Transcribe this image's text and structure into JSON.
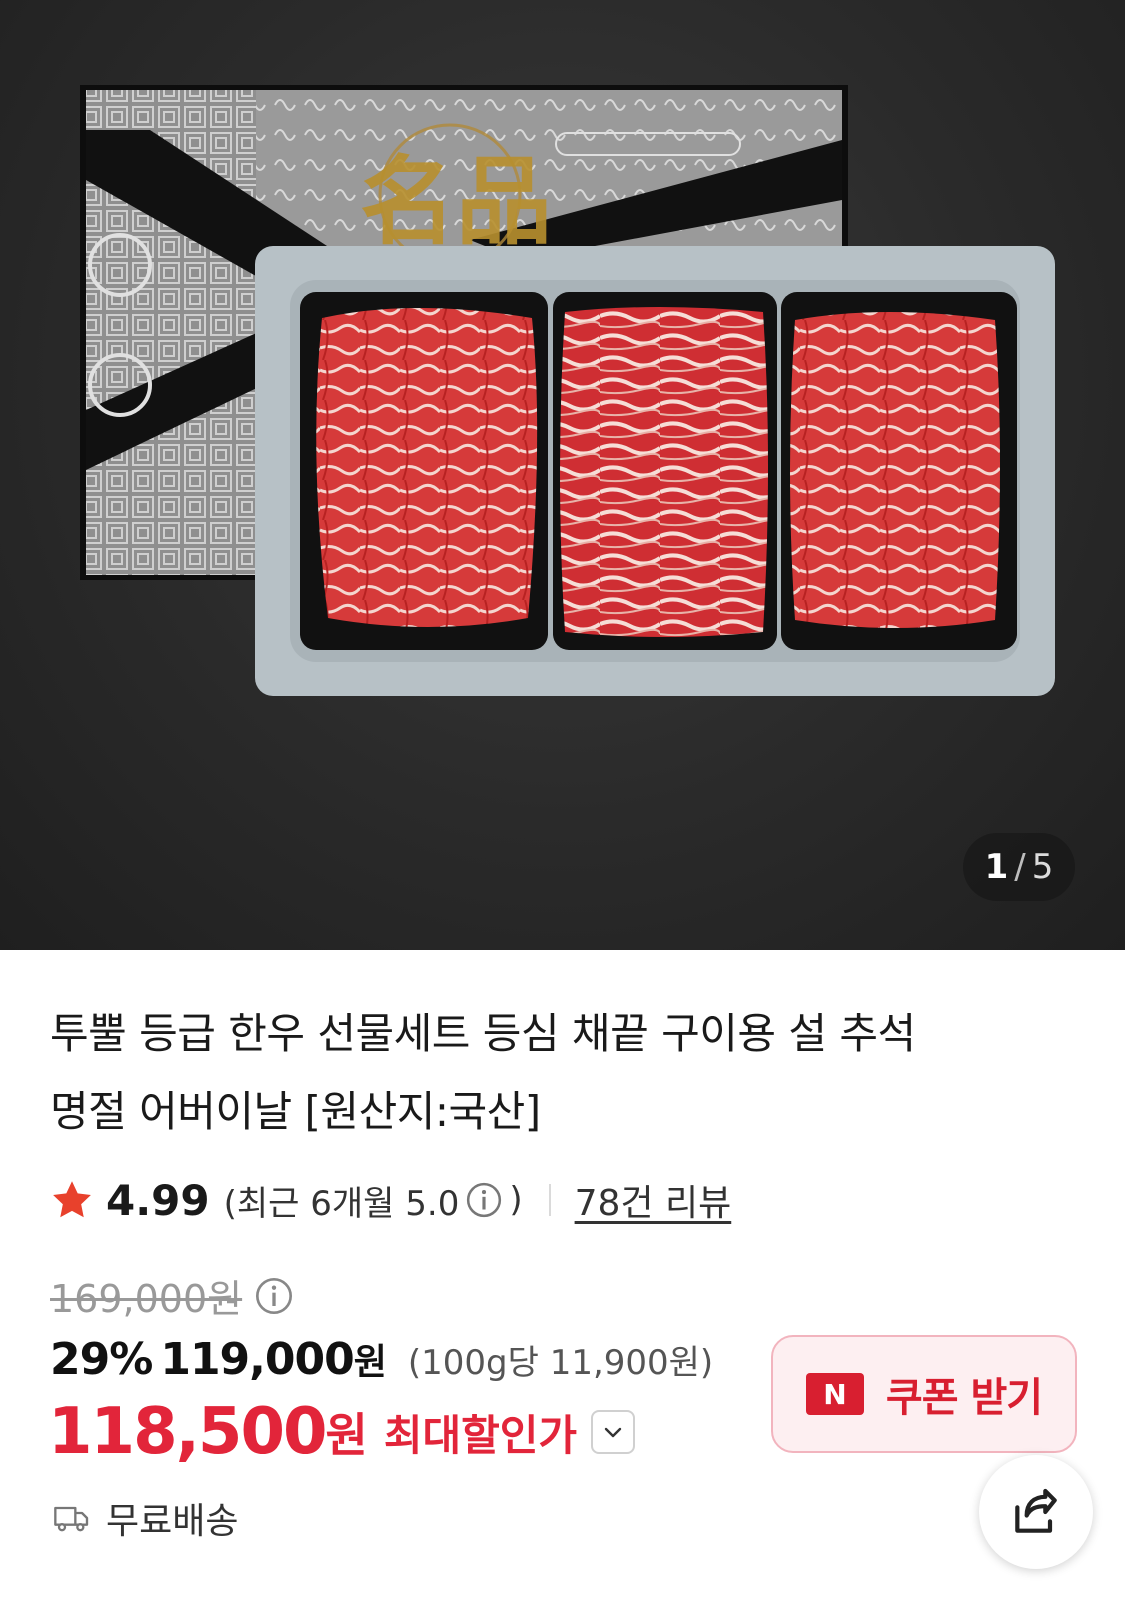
{
  "gallery": {
    "current": "1",
    "separator": "/",
    "total": "5",
    "box_lid_seal_text": "名品"
  },
  "product": {
    "title_line1": "투뿔 등급 한우 선물세트 등심 채끝 구이용 설 추석",
    "title_line2": "명절 어버이날 [원산지:국산]"
  },
  "rating": {
    "score": "4.99",
    "recent_label": "(최근 6개월 5.0",
    "recent_close": ")",
    "review_link": "78건 리뷰",
    "star_color": "#e8412c"
  },
  "price": {
    "original": "169,000원",
    "discount_rate": "29%",
    "sale_price": "119,000",
    "sale_won": "원",
    "unit_price": "(100g당 11,900원)",
    "max_price": "118,500",
    "max_won": "원",
    "max_label": "최대할인가",
    "accent_color": "#e2253a"
  },
  "coupon": {
    "icon_text": "N",
    "label": "쿠폰 받기"
  },
  "shipping": {
    "label": "무료배송"
  },
  "icons": {
    "share": "share-icon",
    "truck": "truck-icon",
    "info": "info-icon",
    "chevron": "chevron-down-icon",
    "star": "star-icon"
  }
}
